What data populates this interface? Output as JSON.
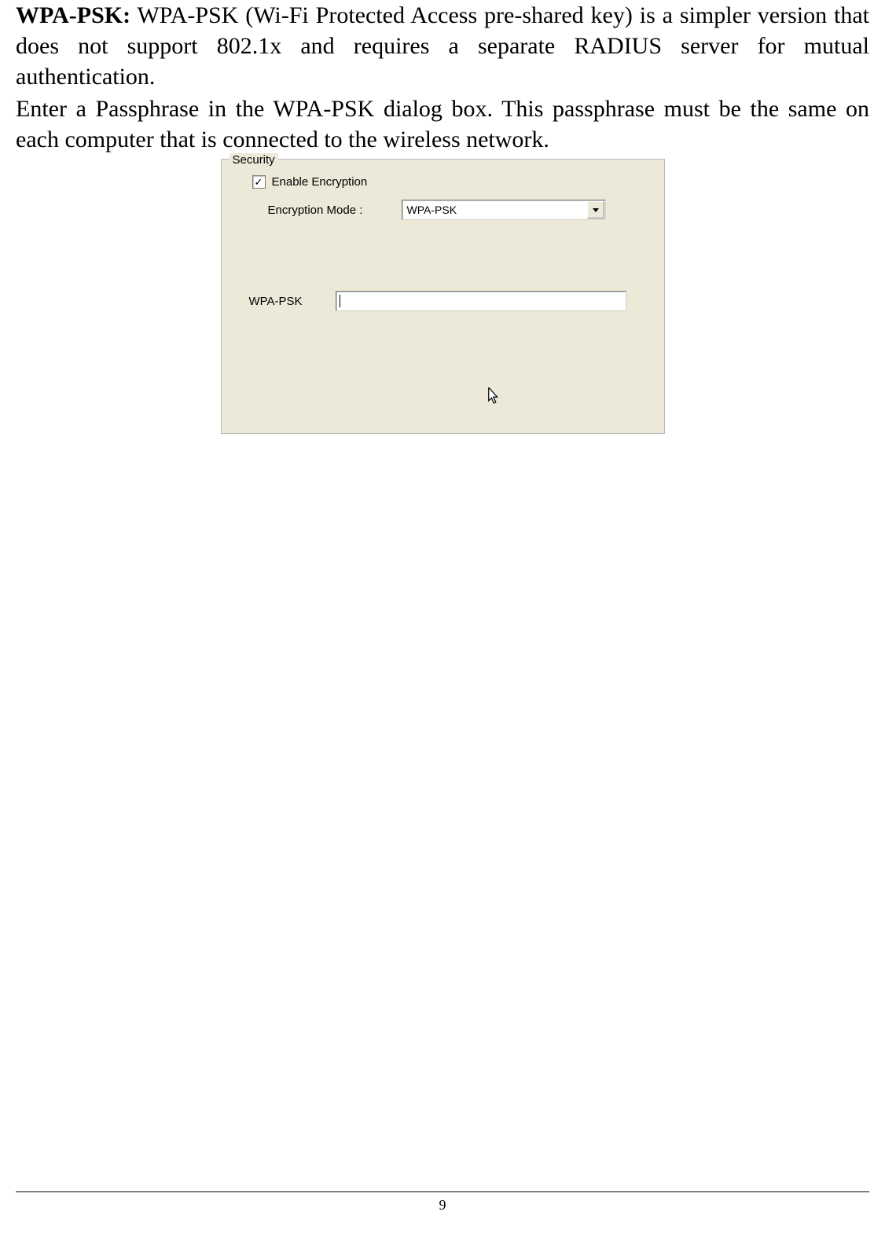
{
  "paragraph1": {
    "bold_lead": "WPA-PSK:",
    "rest": " WPA-PSK (Wi-Fi Protected Access pre-shared key) is a simpler version that does not support 802.1x and requires a separate RADIUS server for mutual authentication."
  },
  "paragraph2": "Enter a Passphrase in the WPA-PSK dialog box. This passphrase must be the same on each computer that is connected to the wireless network.",
  "dialog": {
    "legend": "Security",
    "checkbox": {
      "checked_symbol": "✓",
      "label": "Enable Encryption"
    },
    "mode": {
      "label": "Encryption Mode :",
      "selected": "WPA-PSK"
    },
    "psk": {
      "label": "WPA-PSK",
      "value": ""
    }
  },
  "page_number": "9"
}
